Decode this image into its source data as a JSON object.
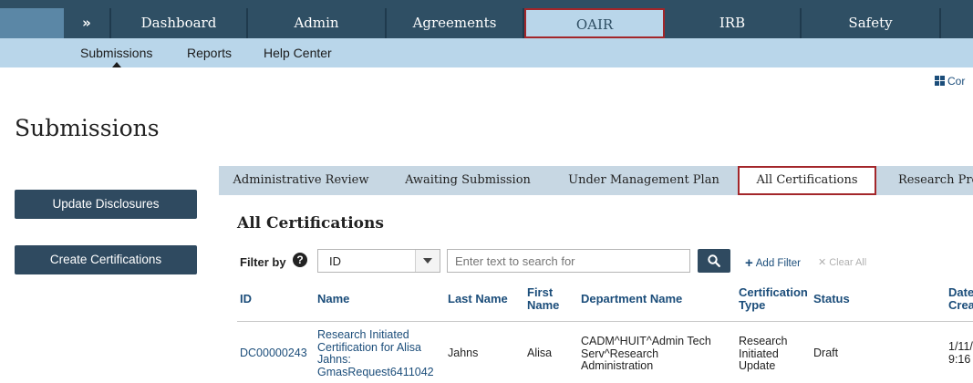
{
  "top_nav": {
    "toggle_label": "»",
    "tabs": [
      {
        "label": "Dashboard"
      },
      {
        "label": "Admin"
      },
      {
        "label": "Agreements"
      },
      {
        "label": "OAIR",
        "active": true
      },
      {
        "label": "IRB"
      },
      {
        "label": "Safety"
      }
    ]
  },
  "sub_nav": {
    "items": [
      {
        "label": "Submissions",
        "active": true
      },
      {
        "label": "Reports"
      },
      {
        "label": "Help Center"
      }
    ]
  },
  "corner_link": {
    "label": "Cor",
    "icon": "grid-icon"
  },
  "page": {
    "title": "Submissions"
  },
  "sidebar": {
    "buttons": [
      {
        "label": "Update Disclosures"
      },
      {
        "label": "Create Certifications"
      }
    ]
  },
  "tabs": [
    {
      "label": "Administrative Review"
    },
    {
      "label": "Awaiting Submission"
    },
    {
      "label": "Under Management Plan"
    },
    {
      "label": "All Certifications",
      "active": true
    },
    {
      "label": "Research Pro"
    }
  ],
  "section": {
    "title": "All Certifications"
  },
  "filter": {
    "label": "Filter by",
    "help_icon": "question-circle-icon",
    "selected": "ID",
    "placeholder": "Enter text to search for",
    "search_icon": "search-icon",
    "add_filter": "Add Filter",
    "clear_all": "Clear All"
  },
  "table": {
    "headers": {
      "id": "ID",
      "name": "Name",
      "last_name": "Last Name",
      "first_name_1": "First",
      "first_name_2": "Name",
      "department": "Department Name",
      "cert_type_1": "Certification",
      "cert_type_2": "Type",
      "status": "Status",
      "date_1": "Date",
      "date_2": "Crea"
    },
    "rows": [
      {
        "id": "DC00000243",
        "name_1": "Research Initiated",
        "name_2": "Certification for Alisa",
        "name_3": "Jahns:",
        "name_4": "GmasRequest6411042",
        "last_name": "Jahns",
        "first_name": "Alisa",
        "dept_1": "CADM^HUIT^Admin Tech",
        "dept_2": "Serv^Research",
        "dept_3": "Administration",
        "type_1": "Research",
        "type_2": "Initiated",
        "type_3": "Update",
        "status": "Draft",
        "date_1": "1/11/",
        "date_2": "9:16"
      }
    ]
  },
  "colors": {
    "nav_dark": "#2f4f64",
    "nav_light": "#b9d6ea",
    "highlight_border": "#a3262a",
    "button": "#2f4a60",
    "link": "#1b4d7a"
  }
}
